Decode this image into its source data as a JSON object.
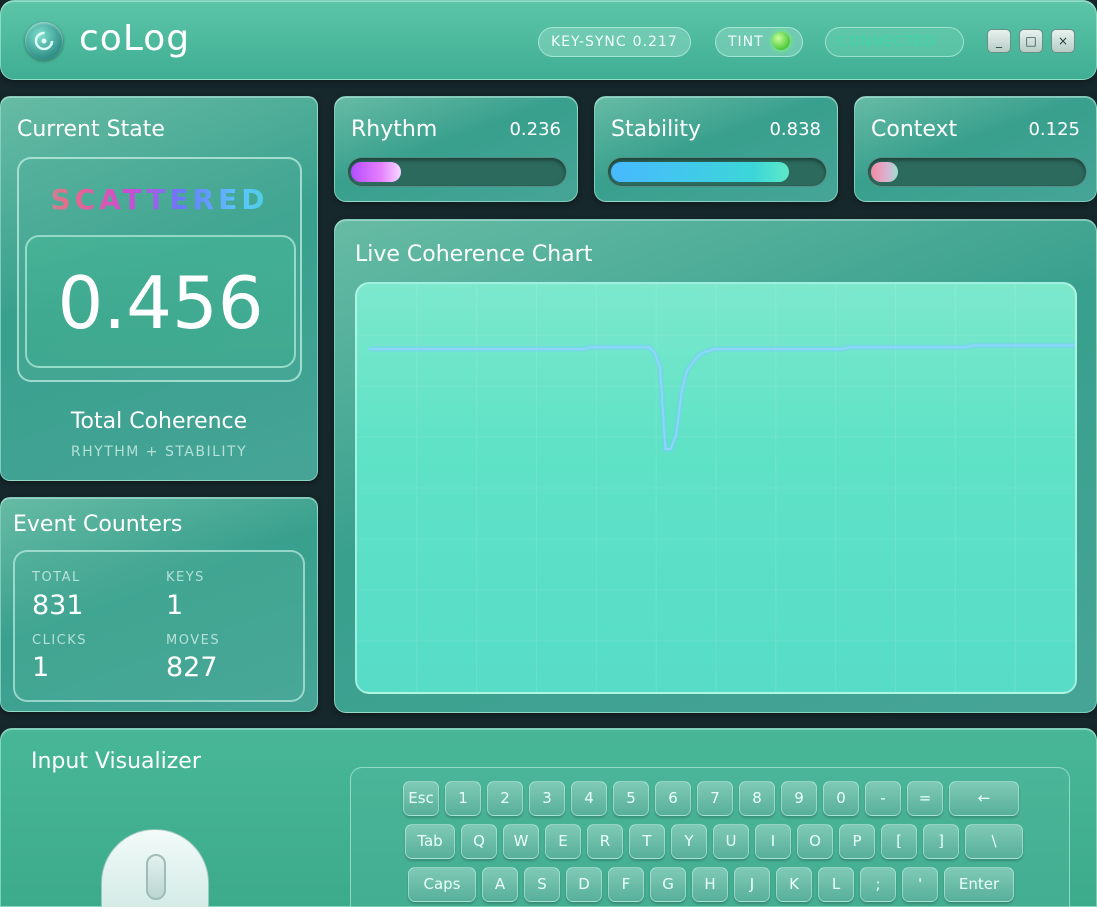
{
  "header": {
    "app_title": "coLog",
    "key_sync_label": "KEY-SYNC",
    "key_sync_value": "0.217",
    "tint_label": "TINT",
    "connection_status": "CONNECTED",
    "window_buttons": [
      "_",
      "□",
      "×"
    ]
  },
  "state": {
    "title": "Current State",
    "state_word": "SCATTERED",
    "value": "0.456",
    "total_label": "Total Coherence",
    "total_sub": "RHYTHM + STABILITY"
  },
  "metrics": [
    {
      "label": "Rhythm",
      "value": "0.236",
      "level": 0.236,
      "fill": "linear-gradient(90deg,#b44cff,#e680ff 60%,#f6d9ff)"
    },
    {
      "label": "Stability",
      "value": "0.838",
      "level": 0.838,
      "fill": "linear-gradient(90deg,#48b9ff,#3cd6d8 80%,#5ee8c8)"
    },
    {
      "label": "Context",
      "value": "0.125",
      "level": 0.125,
      "fill": "linear-gradient(90deg,#f58aa0,#d9b3d2 60%,#9fe0d0)"
    }
  ],
  "chart": {
    "title": "Live Coherence Chart"
  },
  "chart_data": {
    "type": "line",
    "title": "Live Coherence Chart",
    "xlabel": "",
    "ylabel": "",
    "grid": true,
    "series": [
      {
        "values": [
          0.84,
          0.84,
          0.84,
          0.84,
          0.84,
          0.84,
          0.84,
          0.84,
          0.84,
          0.84,
          0.84,
          0.84,
          0.84,
          0.84,
          0.84,
          0.84,
          0.84,
          0.84,
          0.84,
          0.84,
          0.84,
          0.84,
          0.84,
          0.84,
          0.84,
          0.84,
          0.84,
          0.84,
          0.84,
          0.84,
          0.84,
          0.84,
          0.84,
          0.84,
          0.84,
          0.84,
          0.84,
          0.84,
          0.84,
          0.84,
          0.84,
          0.845,
          0.845,
          0.845,
          0.845,
          0.845,
          0.845,
          0.845,
          0.845,
          0.845,
          0.845,
          0.845,
          0.845,
          0.83,
          0.79,
          0.56,
          0.56,
          0.6,
          0.72,
          0.78,
          0.8,
          0.82,
          0.83,
          0.835,
          0.84,
          0.84,
          0.84,
          0.84,
          0.84,
          0.84,
          0.84,
          0.84,
          0.84,
          0.84,
          0.84,
          0.84,
          0.84,
          0.84,
          0.84,
          0.84,
          0.84,
          0.84,
          0.84,
          0.84,
          0.84,
          0.84,
          0.84,
          0.84,
          0.84,
          0.845,
          0.845,
          0.845,
          0.845,
          0.845,
          0.845,
          0.845,
          0.845,
          0.845,
          0.845,
          0.845,
          0.845,
          0.845,
          0.845,
          0.845,
          0.845,
          0.845,
          0.845,
          0.845,
          0.845,
          0.845,
          0.845,
          0.845,
          0.85,
          0.85,
          0.85,
          0.85,
          0.85,
          0.85,
          0.85,
          0.85,
          0.85,
          0.85,
          0.85,
          0.85,
          0.85,
          0.85,
          0.85,
          0.85,
          0.85,
          0.85,
          0.85,
          0.85
        ]
      }
    ],
    "ylim": [
      0,
      1
    ]
  },
  "counters": {
    "title": "Event Counters",
    "items": [
      {
        "label": "TOTAL",
        "value": "831"
      },
      {
        "label": "KEYS",
        "value": "1"
      },
      {
        "label": "CLICKS",
        "value": "1"
      },
      {
        "label": "MOVES",
        "value": "827"
      }
    ]
  },
  "input": {
    "title": "Input Visualizer",
    "keys_row1": [
      "Esc",
      "1",
      "2",
      "3",
      "4",
      "5",
      "6",
      "7",
      "8",
      "9",
      "0",
      "-",
      "=",
      "←"
    ],
    "keys_row2": [
      "Tab",
      "Q",
      "W",
      "E",
      "R",
      "T",
      "Y",
      "U",
      "I",
      "O",
      "P",
      "[",
      "]",
      "\\"
    ],
    "keys_row3": [
      "Caps",
      "A",
      "S",
      "D",
      "F",
      "G",
      "H",
      "J",
      "K",
      "L",
      ";",
      "'",
      "Enter"
    ]
  }
}
